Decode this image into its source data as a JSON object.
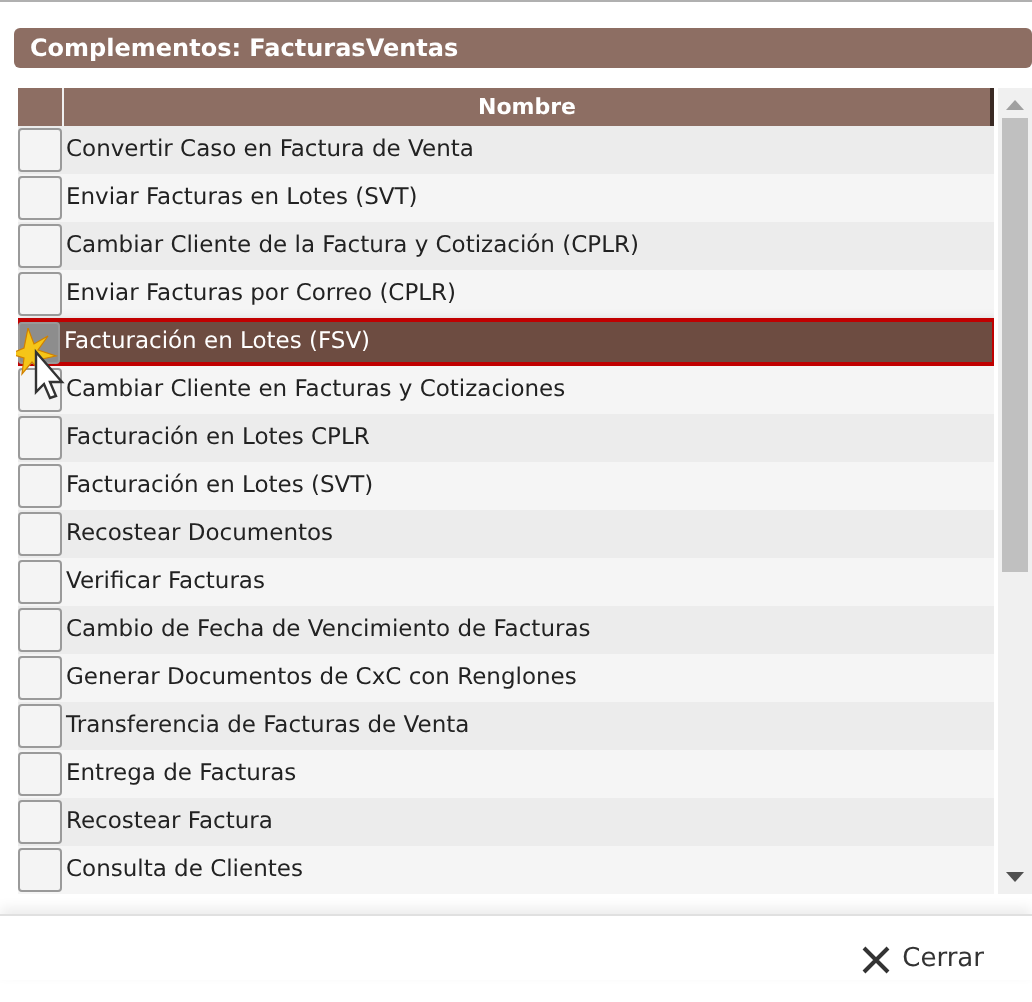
{
  "title": "Complementos: FacturasVentas",
  "table": {
    "columns": [
      "Nombre"
    ],
    "rows": [
      {
        "name": "Convertir Caso en Factura de Venta",
        "selected": false
      },
      {
        "name": "Enviar Facturas en Lotes (SVT)",
        "selected": false
      },
      {
        "name": "Cambiar Cliente de la Factura y Cotización (CPLR)",
        "selected": false
      },
      {
        "name": "Enviar Facturas por Correo (CPLR)",
        "selected": false
      },
      {
        "name": "Facturación en Lotes (FSV)",
        "selected": true
      },
      {
        "name": "Cambiar Cliente en Facturas y Cotizaciones",
        "selected": false
      },
      {
        "name": "Facturación en Lotes CPLR",
        "selected": false
      },
      {
        "name": "Facturación en Lotes (SVT)",
        "selected": false
      },
      {
        "name": "Recostear Documentos",
        "selected": false
      },
      {
        "name": "Verificar Facturas",
        "selected": false
      },
      {
        "name": "Cambio de Fecha de Vencimiento de Facturas",
        "selected": false
      },
      {
        "name": "Generar Documentos de CxC con Renglones",
        "selected": false
      },
      {
        "name": "Transferencia de Facturas de Venta",
        "selected": false
      },
      {
        "name": "Entrega de Facturas",
        "selected": false
      },
      {
        "name": "Recostear Factura",
        "selected": false
      },
      {
        "name": "Consulta de Clientes",
        "selected": false
      }
    ]
  },
  "close_button": "Cerrar"
}
